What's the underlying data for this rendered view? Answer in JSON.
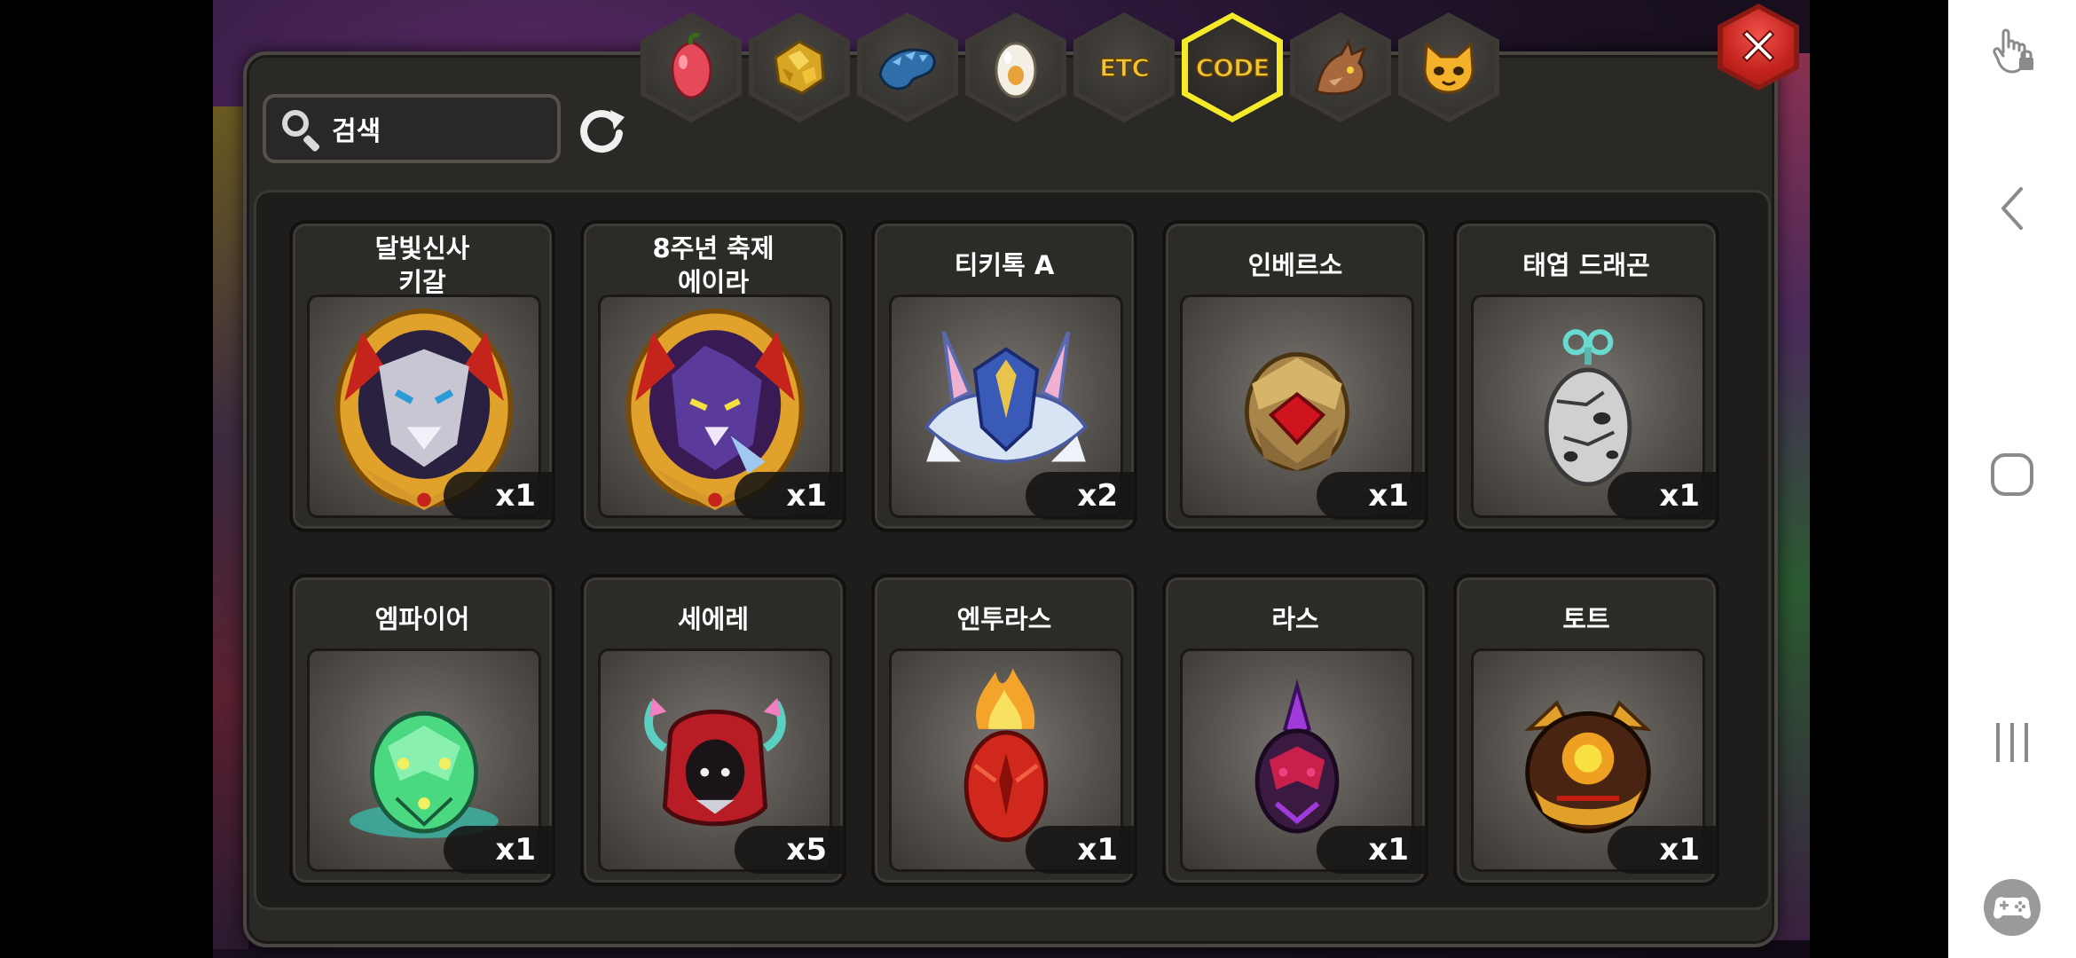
{
  "tabs": [
    {
      "icon": "fruit-icon",
      "label": ""
    },
    {
      "icon": "gold-ore-icon",
      "label": ""
    },
    {
      "icon": "blue-dragon-icon",
      "label": ""
    },
    {
      "icon": "egg-icon",
      "label": ""
    },
    {
      "icon": "etc-icon",
      "label": "ETC"
    },
    {
      "icon": "code-icon",
      "label": "CODE"
    },
    {
      "icon": "dragon-head-icon",
      "label": ""
    },
    {
      "icon": "pet-face-icon",
      "label": ""
    }
  ],
  "active_tab": "CODE",
  "search": {
    "value": "검색"
  },
  "items": [
    {
      "name": "달빛신사\n키갈",
      "qty": "x1",
      "icon": "wolf-medallion-icon"
    },
    {
      "name": "8주년 축제\n에이라",
      "qty": "x1",
      "icon": "purple-beast-medallion-icon"
    },
    {
      "name": "티키톡 A",
      "qty": "x2",
      "icon": "crystal-wing-helm-icon"
    },
    {
      "name": "인베르소",
      "qty": "x1",
      "icon": "gold-ruby-egg-icon"
    },
    {
      "name": "태엽 드래곤",
      "qty": "x1",
      "icon": "windup-egg-icon"
    },
    {
      "name": "엠파이어",
      "qty": "x1",
      "icon": "green-egg-icon"
    },
    {
      "name": "세에레",
      "qty": "x5",
      "icon": "red-hood-icon"
    },
    {
      "name": "엔투라스",
      "qty": "x1",
      "icon": "flame-egg-icon"
    },
    {
      "name": "라스",
      "qty": "x1",
      "icon": "dark-crystal-egg-icon"
    },
    {
      "name": "토트",
      "qty": "x1",
      "icon": "lava-egg-icon"
    }
  ],
  "colors": {
    "active_tab_border": "#f4ea2a",
    "close_button": "#d8241d",
    "panel": "#2b2926"
  }
}
